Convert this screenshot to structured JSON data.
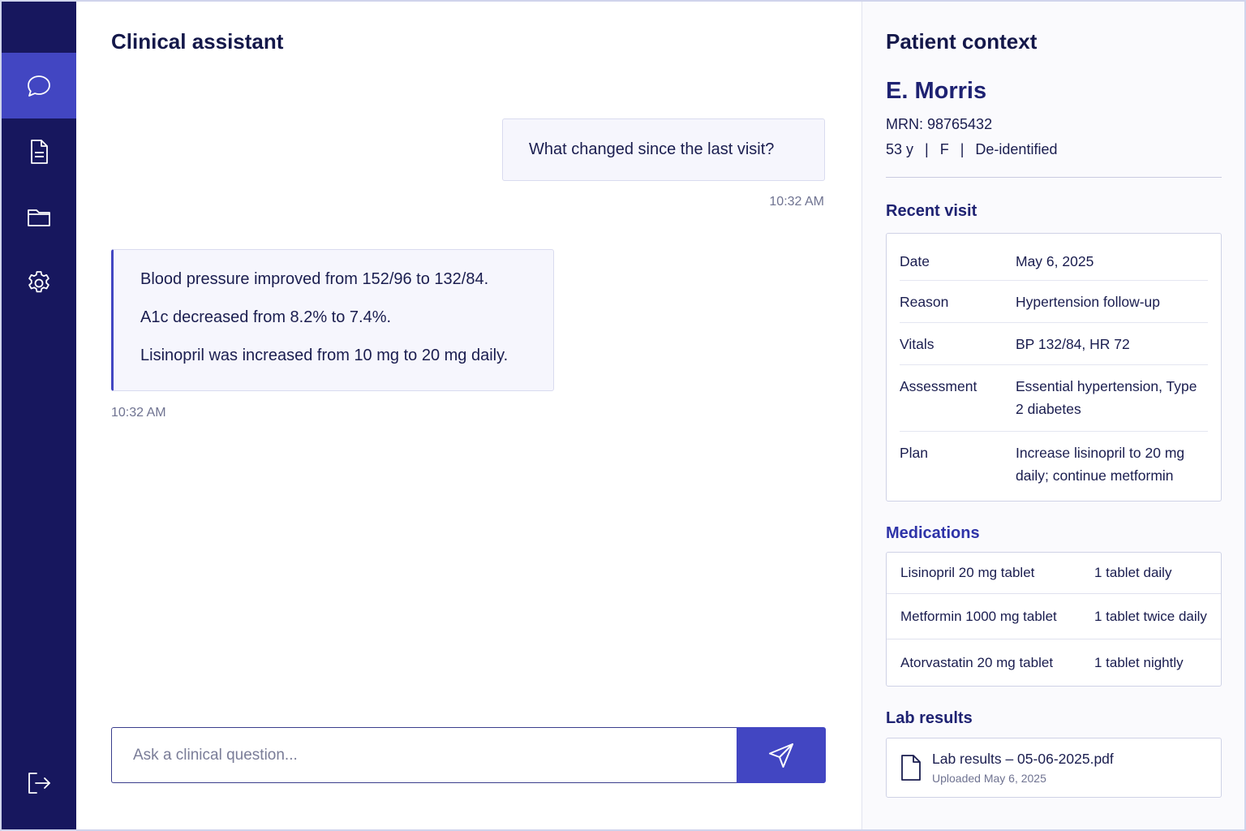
{
  "nav": {
    "items": [
      {
        "icon": "chat-icon",
        "label": "Chat",
        "active": true
      },
      {
        "icon": "document-icon",
        "label": "Documents",
        "active": false
      },
      {
        "icon": "folder-icon",
        "label": "Files",
        "active": false
      },
      {
        "icon": "gear-icon",
        "label": "Settings",
        "active": false
      }
    ],
    "logout_icon": "logout-icon"
  },
  "chat": {
    "title": "Clinical assistant",
    "user_message": "What changed since the last visit?",
    "user_time": "10:32 AM",
    "assistant_lines": [
      "Blood pressure improved from 152/96 to 132/84.",
      "A1c decreased from 8.2% to 7.4%.",
      "Lisinopril was increased from 10 mg to 20 mg daily."
    ],
    "assistant_time": "10:32 AM",
    "input_placeholder": "Ask a clinical question...",
    "send_icon": "send-icon"
  },
  "patient": {
    "panel_title": "Patient context",
    "name": "E. Morris",
    "mrn": "MRN: 98765432",
    "age": "53 y",
    "sex": "F",
    "status": "De-identified",
    "separator": "|"
  },
  "visit": {
    "title": "Recent visit",
    "rows": [
      {
        "label": "Date",
        "value": "May 6, 2025"
      },
      {
        "label": "Reason",
        "value": "Hypertension follow-up"
      },
      {
        "label": "Vitals",
        "value": "BP 132/84, HR 72"
      },
      {
        "label": "Assessment",
        "value": "Essential hypertension, Type 2 diabetes"
      },
      {
        "label": "Plan",
        "value": "Increase lisinopril to 20 mg daily; continue metformin"
      }
    ]
  },
  "medications": {
    "title": "Medications",
    "rows": [
      {
        "name": "Lisinopril 20 mg tablet",
        "dose": "1 tablet daily"
      },
      {
        "name": "Metformin 1000 mg tablet",
        "dose": "1 tablet twice daily"
      },
      {
        "name": "Atorvastatin 20 mg tablet",
        "dose": "1 tablet nightly"
      }
    ]
  },
  "labs": {
    "title": "Lab results",
    "file_name": "Lab results – 05-06-2025.pdf",
    "uploaded": "Uploaded May 6, 2025",
    "icon": "file-icon"
  },
  "colors": {
    "sidebar": "#17175e",
    "accent": "#4246c2",
    "heading": "#1e2272"
  }
}
